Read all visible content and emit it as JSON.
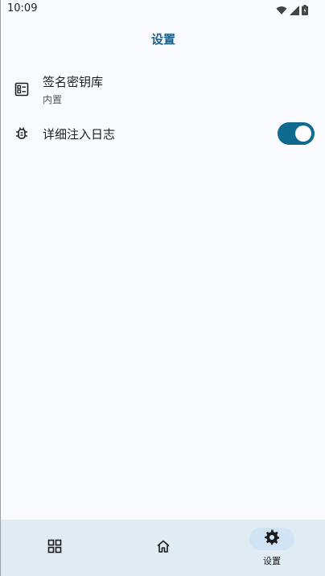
{
  "status_bar": {
    "time": "10:09",
    "icons": [
      "wifi-icon",
      "signal-icon",
      "battery-icon"
    ]
  },
  "app_bar": {
    "title": "设置"
  },
  "settings": {
    "keystore": {
      "title": "签名密钥库",
      "subtitle": "内置",
      "icon": "keystore-icon"
    },
    "verbose_log": {
      "title": "详细注入日志",
      "icon": "bug-icon",
      "enabled": true
    }
  },
  "bottom_nav": {
    "items": [
      {
        "icon": "apps-grid-icon",
        "label": ""
      },
      {
        "icon": "home-icon",
        "label": ""
      },
      {
        "icon": "gear-icon",
        "label": "设置",
        "active": true
      }
    ]
  },
  "colors": {
    "accent": "#0e6b8f",
    "title": "#1b5f87",
    "background": "#f9fbff",
    "nav_background": "#e1ebf2",
    "nav_active_pill": "#d0e4f5"
  }
}
